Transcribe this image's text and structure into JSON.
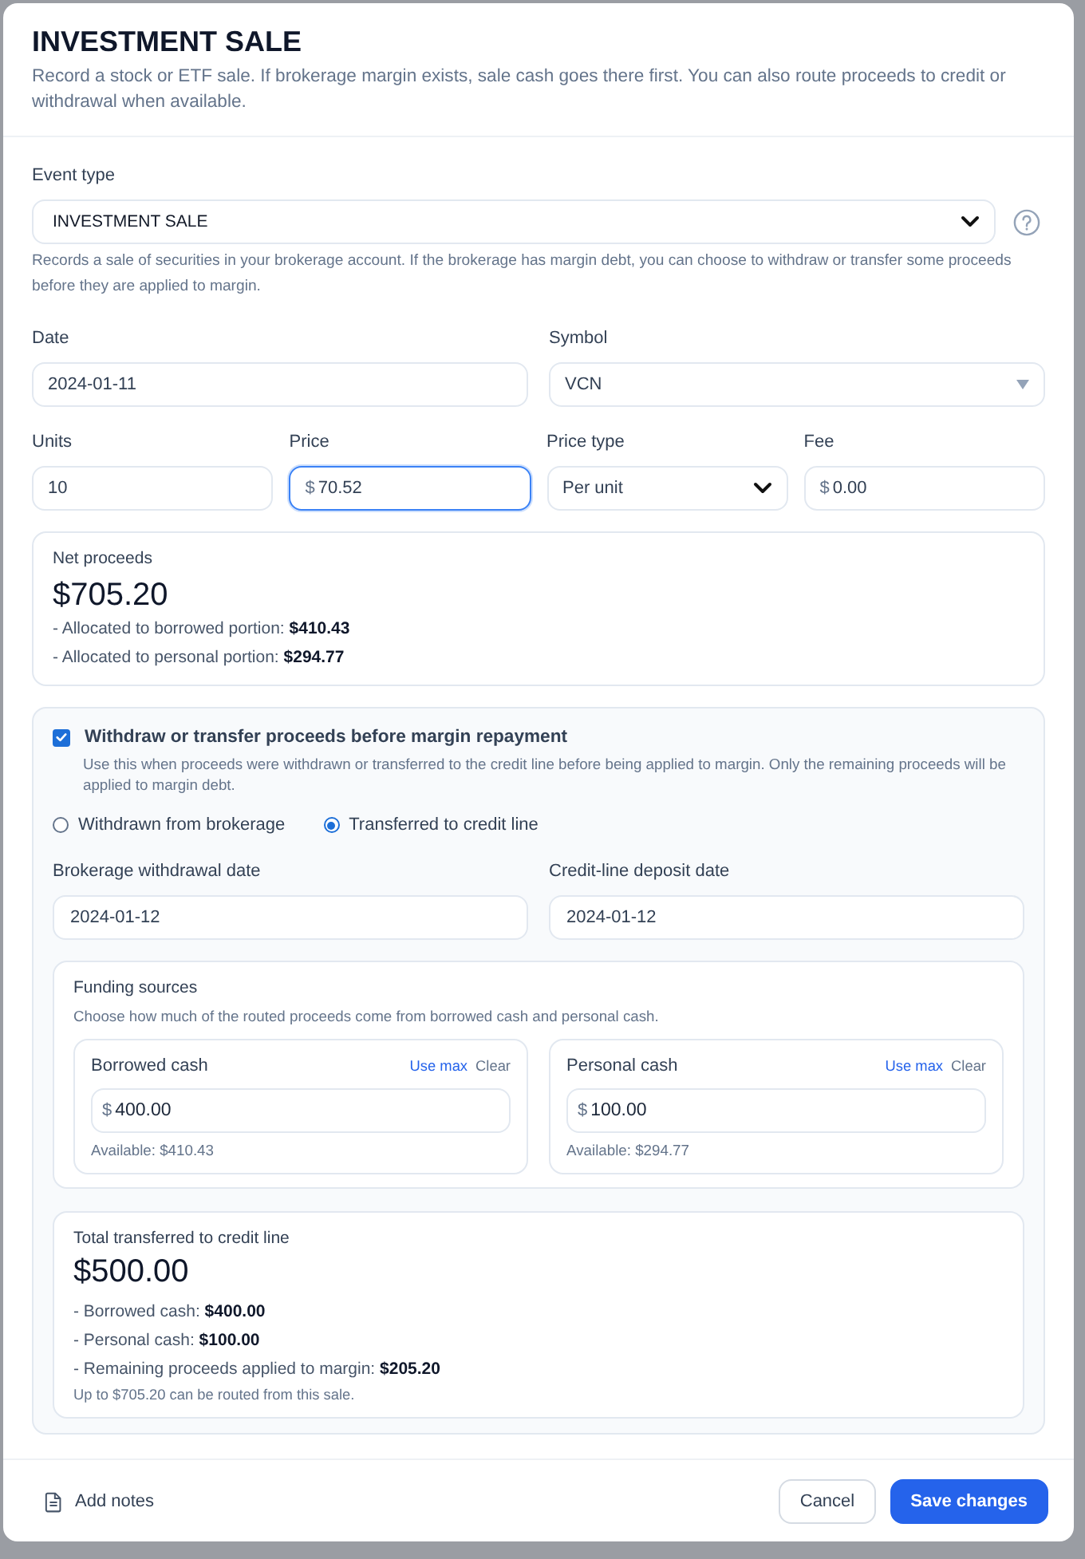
{
  "dialog": {
    "title": "INVESTMENT SALE",
    "subtitle": "Record a stock or ETF sale. If brokerage margin exists, sale cash goes there first. You can also route proceeds to credit or withdrawal when available."
  },
  "event_type": {
    "label": "Event type",
    "value": "INVESTMENT SALE",
    "description": "Records a sale of securities in your brokerage account. If the brokerage has margin debt, you can choose to withdraw or transfer some proceeds before they are applied to margin."
  },
  "detail_rows": [
    {
      "fields": [
        {
          "label": "Date",
          "kind": "text",
          "value": "2024-01-11",
          "focused": false
        },
        {
          "label": "Symbol",
          "kind": "combo",
          "value": "VCN",
          "focused": false
        }
      ]
    },
    {
      "fields": [
        {
          "label": "Units",
          "kind": "text",
          "value": "10",
          "focused": false
        },
        {
          "label": "Price",
          "kind": "currency",
          "prefix": "$",
          "value": "70.52",
          "focused": true
        },
        {
          "label": "Price type",
          "kind": "select",
          "value": "Per unit",
          "focused": false
        },
        {
          "label": "Fee",
          "kind": "currency",
          "prefix": "$",
          "value": "0.00",
          "focused": false
        }
      ]
    }
  ],
  "net_proceeds": {
    "label": "Net proceeds",
    "amount": "$705.20",
    "lines": [
      "- Allocated to borrowed portion: **$410.43**",
      "- Allocated to personal portion: **$294.77**"
    ]
  },
  "routing": {
    "checkbox": {
      "label": "Withdraw or transfer proceeds before margin repayment",
      "checked": true
    },
    "hint": "Use this when proceeds were withdrawn or transferred to the credit line before being applied to margin. Only the remaining proceeds will be applied to margin debt.",
    "options": [
      {
        "label": "Withdrawn from brokerage",
        "selected": false
      },
      {
        "label": "Transferred to credit line",
        "selected": true
      }
    ],
    "dates": [
      {
        "label": "Brokerage withdrawal date",
        "value": "2024-01-12"
      },
      {
        "label": "Credit-line deposit date",
        "value": "2024-01-12"
      }
    ],
    "funding": {
      "title": "Funding sources",
      "hint": "Choose how much of the routed proceeds come from borrowed cash and personal cash.",
      "sources": [
        {
          "label": "Borrowed cash",
          "use_max": "Use max",
          "clear": "Clear",
          "prefix": "$",
          "value": "400.00",
          "available": "Available: $410.43"
        },
        {
          "label": "Personal cash",
          "use_max": "Use max",
          "clear": "Clear",
          "prefix": "$",
          "value": "100.00",
          "available": "Available: $294.77"
        }
      ]
    },
    "total": {
      "label": "Total transferred to credit line",
      "amount": "$500.00",
      "lines": [
        "- Borrowed cash: **$400.00**",
        "- Personal cash: **$100.00**",
        "- Remaining proceeds applied to margin: **$205.20**"
      ],
      "note": "Up to $705.20 can be routed from this sale."
    }
  },
  "footer": {
    "notes": "Add notes",
    "buttons": [
      {
        "label": "Cancel",
        "kind": "secondary"
      },
      {
        "label": "Save changes",
        "kind": "primary"
      }
    ]
  }
}
